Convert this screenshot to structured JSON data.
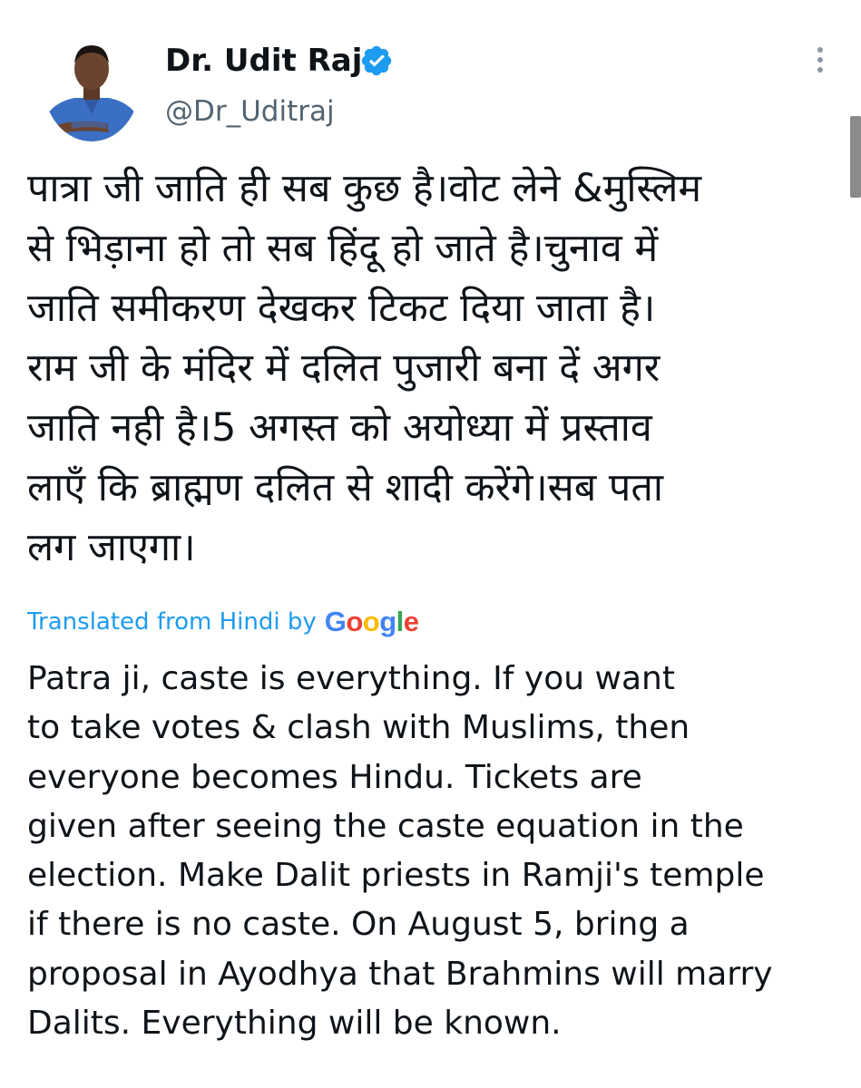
{
  "author": {
    "name": "Dr. Udit Raj",
    "handle": "@Dr_Uditraj",
    "verified": true
  },
  "icons": {
    "verified": "verified-badge-icon",
    "more": "more-vertical-icon"
  },
  "colors": {
    "verified": "#1d9bf0",
    "link": "#1d9bf0",
    "text": "#0f1419",
    "secondary": "#536471"
  },
  "tweet": {
    "original_lines": [
      "पात्रा जी जाति ही सब कुछ है।वोट लेने &मुस्लिम",
      "से भिड़ाना हो तो सब हिंदू हो जाते है।चुनाव में",
      "जाति समीकरण देखकर टिकट दिया जाता है।",
      "राम जी के मंदिर में दलित पुजारी बना दें अगर",
      "जाति नही है।5 अगस्त को अयोध्या में प्रस्ताव",
      "लाएँ कि ब्राह्मण दलित से शादी करेंगे।सब पता",
      "लग जाएगा।"
    ],
    "translation_label": "Translated from Hindi by",
    "translation_provider": "Google",
    "translated_lines": [
      "Patra ji, caste is everything. If you want",
      "to take votes & clash with Muslims, then",
      "everyone becomes Hindu. Tickets are",
      "given after seeing the caste equation in the",
      "election. Make Dalit priests in Ramji's temple",
      "if there is no caste. On August 5, bring a",
      "proposal in Ayodhya that Brahmins will marry",
      "Dalits. Everything will be known."
    ]
  }
}
